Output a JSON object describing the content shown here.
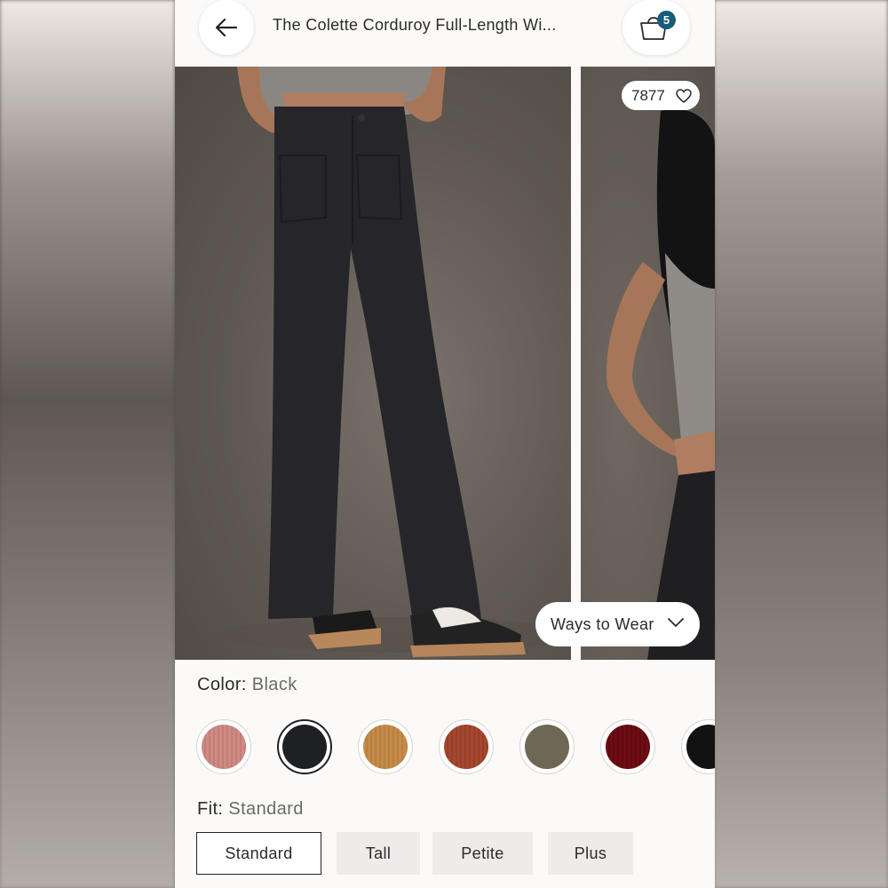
{
  "header": {
    "title": "The Colette Corduroy Full-Length Wi...",
    "back_icon": "arrow-left-icon",
    "bag_icon": "shopping-bag-icon",
    "bag_count": "5",
    "badge_color": "#1a5a7a"
  },
  "gallery": {
    "like_count": "7877",
    "like_icon": "heart-icon",
    "ways_to_wear_label": "Ways to Wear",
    "ways_icon": "chevron-down-icon"
  },
  "color": {
    "label": "Color:",
    "selected_value": "Black",
    "swatches": [
      {
        "name": "pink",
        "color": "#cf8a83"
      },
      {
        "name": "black",
        "color": "#1f2024",
        "selected": true
      },
      {
        "name": "camel",
        "color": "#c48c4a"
      },
      {
        "name": "rust",
        "color": "#a5482f"
      },
      {
        "name": "olive",
        "color": "#6e6753"
      },
      {
        "name": "burgundy",
        "color": "#6f0c12"
      },
      {
        "name": "black-2",
        "color": "#121212"
      }
    ]
  },
  "fit": {
    "label": "Fit:",
    "selected_value": "Standard",
    "options": [
      "Standard",
      "Tall",
      "Petite",
      "Plus"
    ]
  }
}
